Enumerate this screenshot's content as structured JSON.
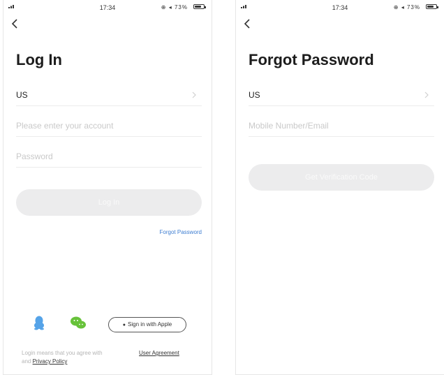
{
  "status_bar": {
    "time": "17:34",
    "battery": "73%",
    "battery_level": 0.73,
    "icons": [
      "signal-icon",
      "location-icon",
      "alarm-icon",
      "battery-icon"
    ]
  },
  "login": {
    "title": "Log In",
    "region": "US",
    "account_placeholder": "Please enter your account",
    "password_placeholder": "Password",
    "login_button": "Log In",
    "forgot_password": "Forgot Password",
    "apple_button": "Sign in with Apple",
    "legal_text": "Login means that you agree with",
    "and": "and",
    "user_agreement": "User Agreement",
    "privacy_policy": "Privacy Policy"
  },
  "forgot": {
    "title": "Forgot Password",
    "region": "US",
    "contact_placeholder": "Mobile Number/Email",
    "verify_button": "Get Verification Code"
  },
  "colors": {
    "link": "#3d7dd1",
    "qq": "#55a3e8",
    "wechat": "#67c23a",
    "disabled_button": "#ececed"
  }
}
